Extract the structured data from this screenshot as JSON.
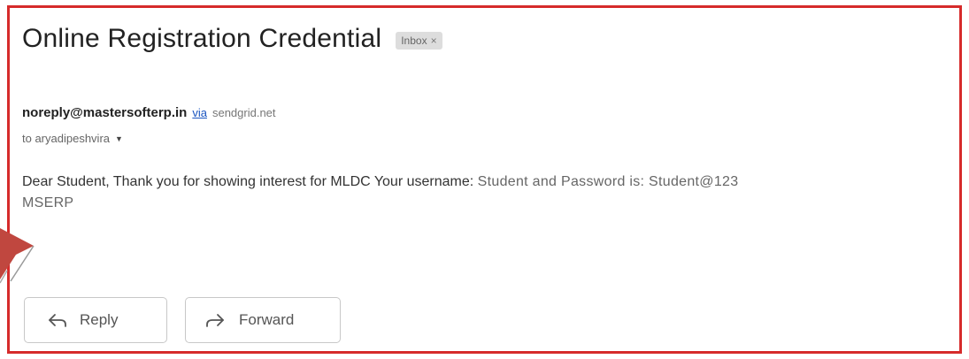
{
  "email": {
    "subject": "Online Registration Credential",
    "label": "Inbox",
    "label_close": "×",
    "sender": "noreply@mastersofterp.in",
    "via_label": "via",
    "via_domain": "sendgrid.net",
    "recipient": "to aryadipeshvira",
    "body_part1": "Dear Student, Thank you for showing interest for MLDC Your username:",
    "body_part2": "Student and Password is: Student@123",
    "body_line2": "MSERP"
  },
  "actions": {
    "reply_label": "Reply",
    "forward_label": "Forward"
  },
  "icons": {
    "reply": "reply-icon",
    "forward": "forward-icon",
    "recipient_caret": "caret-down-icon",
    "annotation_arrow": "arrow-pointer-icon"
  },
  "colors": {
    "highlight_border": "#d62b2b",
    "annotation_arrow": "#c0473f",
    "via_link": "#1a55c0"
  }
}
